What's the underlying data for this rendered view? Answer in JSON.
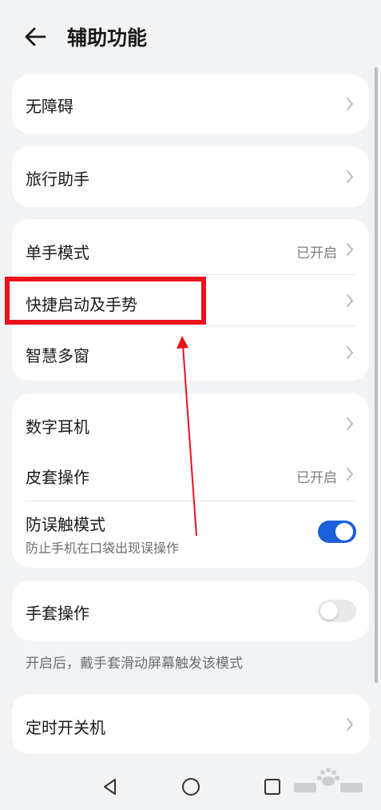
{
  "header": {
    "title": "辅助功能",
    "back_icon": "arrow-left-icon"
  },
  "cards": {
    "accessibility": {
      "label": "无障碍"
    },
    "travel": {
      "label": "旅行助手"
    },
    "group1": {
      "one_hand": {
        "label": "单手模式",
        "value": "已开启"
      },
      "shortcut": {
        "label": "快捷启动及手势"
      },
      "multiwindow": {
        "label": "智慧多窗"
      }
    },
    "group2": {
      "earphone": {
        "label": "数字耳机"
      },
      "cover": {
        "label": "皮套操作",
        "value": "已开启"
      },
      "mistouch": {
        "label": "防误触模式",
        "sub": "防止手机在口袋出现误操作",
        "enabled": true
      }
    },
    "glove": {
      "label": "手套操作",
      "enabled": false,
      "footnote": "开启后，戴手套滑动屏幕触发该模式"
    },
    "timer": {
      "label": "定时开关机"
    }
  },
  "navbar": {
    "back": "triangle-back-icon",
    "home": "circle-home-icon",
    "recents": "square-recents-icon"
  },
  "colors": {
    "background": "#f1f3f5",
    "card": "#ffffff",
    "accent": "#1a60d8",
    "annotation": "#e8131c"
  }
}
